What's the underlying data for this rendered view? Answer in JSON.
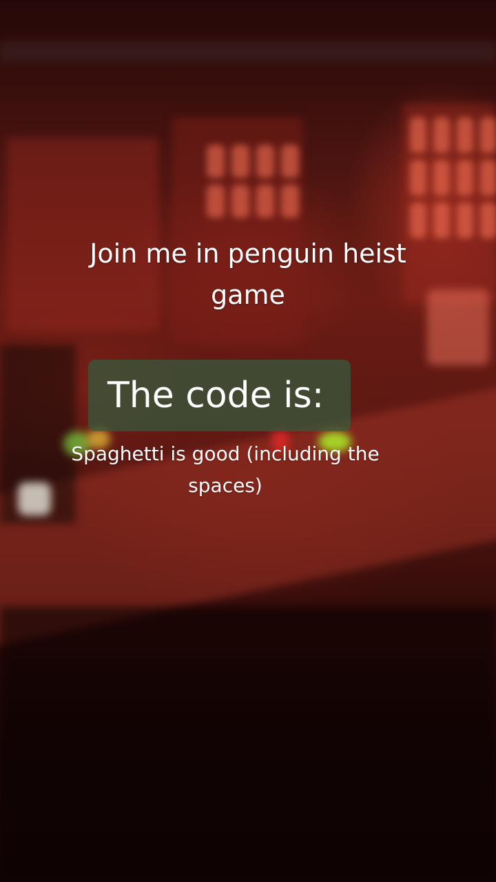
{
  "overlay": {
    "headline": "Join me in penguin heist game",
    "code_label": "The code is:",
    "code_value": "Spaghetti is good (including the spaces)",
    "code_label_background": "#345c3e",
    "text_color": "#ffffff"
  },
  "background": {
    "scene": "blurred red-lit room with control panels",
    "dominant_color": "#6b1c14"
  }
}
